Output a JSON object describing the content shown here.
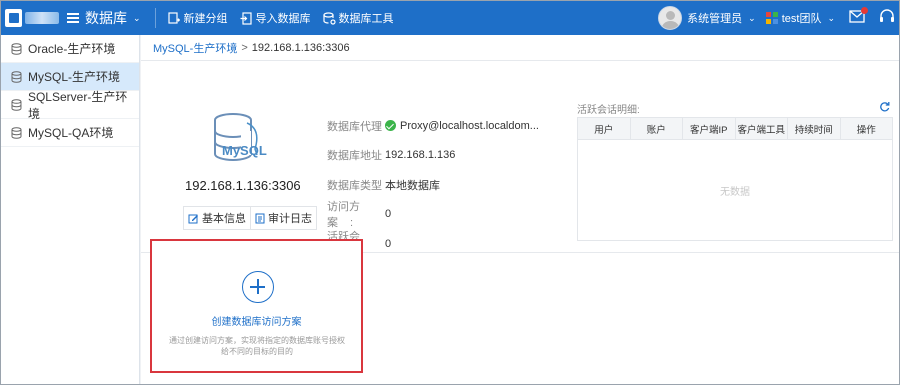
{
  "topbar": {
    "module_title": "数据库",
    "tools": [
      {
        "icon": "new-group-icon",
        "label": "新建分组"
      },
      {
        "icon": "import-icon",
        "label": "导入数据库"
      },
      {
        "icon": "db-tools-icon",
        "label": "数据库工具"
      }
    ],
    "user_name": "系统管理员",
    "team_name": "test团队",
    "brand_color": "#1e6fc8"
  },
  "sidebar": {
    "items": [
      {
        "label": "Oracle-生产环境",
        "active": false
      },
      {
        "label": "MySQL-生产环境",
        "active": true
      },
      {
        "label": "SQLServer-生产环境",
        "active": false
      },
      {
        "label": "MySQL-QA环境",
        "active": false
      }
    ]
  },
  "breadcrumb": {
    "parent": "MySQL-生产环境",
    "separator": ">",
    "current": "192.168.1.136:3306"
  },
  "database": {
    "icon_label": "MySQL",
    "title": "192.168.1.136:3306",
    "buttons": {
      "basic_info": "基本信息",
      "audit_log": "审计日志"
    },
    "fields": [
      {
        "label": "数据库代理",
        "value": "Proxy@localhost.localdom...",
        "status": "ok"
      },
      {
        "label": "数据库地址",
        "value": "192.168.1.136"
      },
      {
        "label": "数据库类型",
        "value": "本地数据库"
      },
      {
        "label": "访问方案",
        "value": "0"
      },
      {
        "label": "活跃会话",
        "value": "0"
      }
    ],
    "colon": ":"
  },
  "sessions": {
    "title": "活跃会话明细:",
    "columns": [
      "用户",
      "账户",
      "客户端IP",
      "客户端工具",
      "持续时间",
      "操作"
    ],
    "empty_text": "无数据"
  },
  "create_card": {
    "title": "创建数据库访问方案",
    "description": "通过创建访问方案，实现将指定的数据库账号授权给不同的目标的目的",
    "highlight_color": "#d9363e"
  }
}
